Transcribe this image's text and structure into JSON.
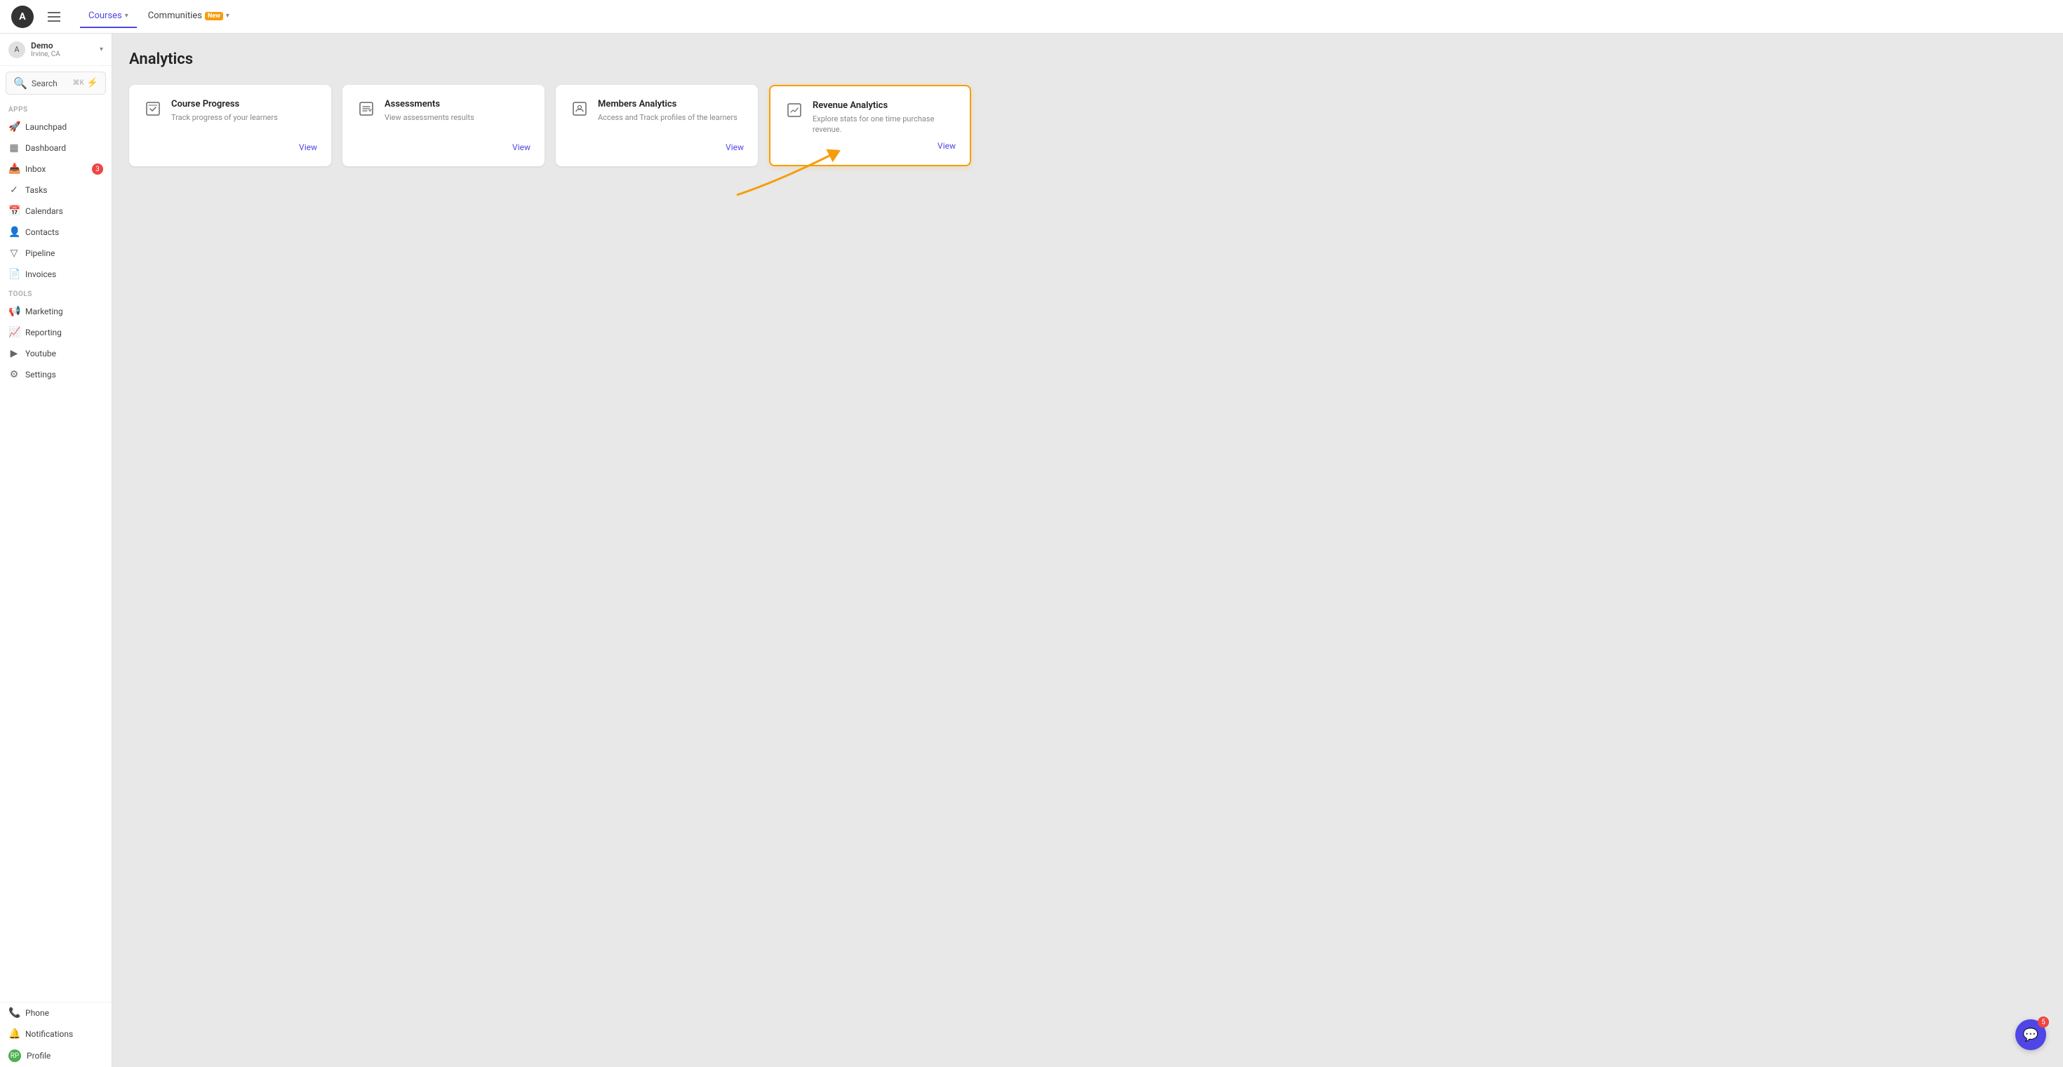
{
  "topNav": {
    "logoText": "A",
    "tabs": [
      {
        "label": "Courses",
        "active": true,
        "hasDropdown": true,
        "badgeNew": false
      },
      {
        "label": "Communities",
        "active": false,
        "hasDropdown": true,
        "badgeNew": true
      }
    ]
  },
  "sidebar": {
    "user": {
      "name": "Demo",
      "location": "Irvine, CA",
      "avatarText": "A"
    },
    "search": {
      "label": "Search",
      "shortcut": "⌘K"
    },
    "appsLabel": "Apps",
    "appItems": [
      {
        "icon": "🚀",
        "label": "Launchpad"
      },
      {
        "icon": "📊",
        "label": "Dashboard"
      },
      {
        "icon": "📥",
        "label": "Inbox",
        "badge": "3"
      },
      {
        "icon": "✓",
        "label": "Tasks"
      },
      {
        "icon": "📅",
        "label": "Calendars"
      },
      {
        "icon": "👤",
        "label": "Contacts"
      },
      {
        "icon": "▽",
        "label": "Pipeline"
      },
      {
        "icon": "📄",
        "label": "Invoices"
      }
    ],
    "toolsLabel": "Tools",
    "toolItems": [
      {
        "icon": "📢",
        "label": "Marketing"
      },
      {
        "icon": "📈",
        "label": "Reporting"
      },
      {
        "icon": "▶",
        "label": "Youtube"
      },
      {
        "icon": "⚙",
        "label": "Settings"
      }
    ],
    "bottomItems": [
      {
        "icon": "📞",
        "label": "Phone"
      },
      {
        "icon": "🔔",
        "label": "Notifications"
      },
      {
        "icon": "👤",
        "label": "Profile",
        "isAvatar": true
      }
    ]
  },
  "mainContent": {
    "pageTitle": "Analytics",
    "cards": [
      {
        "id": "course-progress",
        "title": "Course Progress",
        "description": "Track progress of your learners",
        "viewLabel": "View",
        "highlighted": false
      },
      {
        "id": "assessments",
        "title": "Assessments",
        "description": "View assessments results",
        "viewLabel": "View",
        "highlighted": false
      },
      {
        "id": "members-analytics",
        "title": "Members Analytics",
        "description": "Access and Track profiles of the learners",
        "viewLabel": "View",
        "highlighted": false
      },
      {
        "id": "revenue-analytics",
        "title": "Revenue Analytics",
        "description": "Explore stats for one time purchase revenue.",
        "viewLabel": "View",
        "highlighted": true
      }
    ]
  },
  "chatBubble": {
    "badge": "5"
  }
}
